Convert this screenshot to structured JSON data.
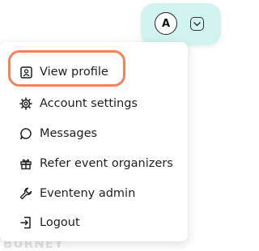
{
  "header": {
    "avatar_initial": "A",
    "avatar_icon": "user-avatar",
    "dropdown_icon": "chevron-down-icon",
    "pill_color": "#d2f4f0"
  },
  "menu": {
    "items": [
      {
        "label": "View profile",
        "icon": "profile-card-icon",
        "highlighted": true
      },
      {
        "label": "Account settings",
        "icon": "gear-icon"
      },
      {
        "label": "Messages",
        "icon": "chat-bubble-icon"
      },
      {
        "label": "Refer event organizers",
        "icon": "gift-icon"
      },
      {
        "label": "Eventeny admin",
        "icon": "wrench-icon"
      },
      {
        "label": "Logout",
        "icon": "logout-icon"
      }
    ]
  },
  "highlight_color": "#f2845a",
  "background_text": "BURNEY"
}
